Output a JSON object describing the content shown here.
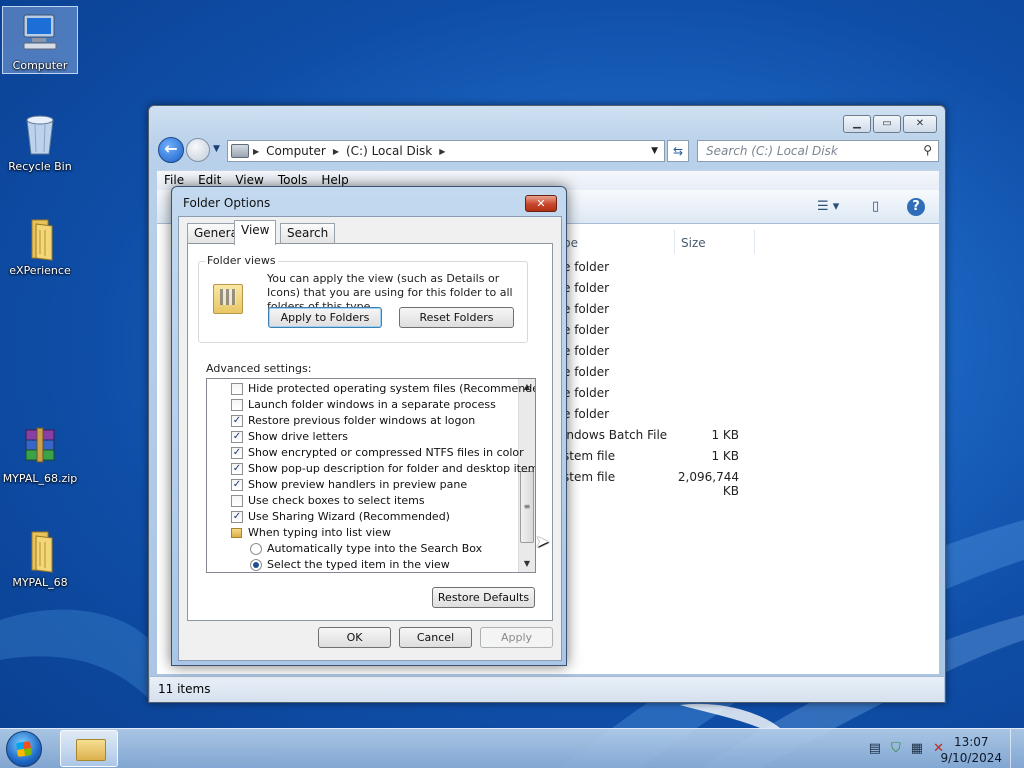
{
  "desktop": {
    "icons": [
      {
        "label": "Computer",
        "icon": "computer-icon"
      },
      {
        "label": "Recycle Bin",
        "icon": "recycle-bin-icon"
      },
      {
        "label": "eXPerience",
        "icon": "folder-icon"
      },
      {
        "label": "MYPAL_68.zip",
        "icon": "winrar-archive-icon"
      },
      {
        "label": "MYPAL_68",
        "icon": "folder-icon"
      }
    ]
  },
  "explorer": {
    "address": {
      "crumbs": [
        "Computer",
        "(C:) Local Disk"
      ]
    },
    "search": {
      "placeholder": "Search (C:) Local Disk"
    },
    "menu": [
      "File",
      "Edit",
      "View",
      "Tools",
      "Help"
    ],
    "columns": {
      "type_partial": "pe",
      "size": "Size"
    },
    "rows": [
      {
        "type": "e folder",
        "size": ""
      },
      {
        "type": "e folder",
        "size": ""
      },
      {
        "type": "e folder",
        "size": ""
      },
      {
        "type": "e folder",
        "size": ""
      },
      {
        "type": "e folder",
        "size": ""
      },
      {
        "type": "e folder",
        "size": ""
      },
      {
        "type": "e folder",
        "size": ""
      },
      {
        "type": "e folder",
        "size": ""
      },
      {
        "type": "indows Batch File",
        "size": "1 KB"
      },
      {
        "type": "stem file",
        "size": "1 KB"
      },
      {
        "type": "stem file",
        "size": "2,096,744 KB"
      }
    ],
    "status": "11 items"
  },
  "dialog": {
    "title": "Folder Options",
    "tabs": [
      "General",
      "View",
      "Search"
    ],
    "active_tab": "View",
    "folder_views": {
      "label": "Folder views",
      "description": "You can apply the view (such as Details or Icons) that you are using for this folder to all folders of this type.",
      "apply_button": "Apply to Folders",
      "reset_button": "Reset Folders"
    },
    "advanced_label": "Advanced settings:",
    "advanced_items": [
      {
        "kind": "checkbox",
        "label": "Hide protected operating system files (Recommended)",
        "checked": false,
        "indent": 0
      },
      {
        "kind": "checkbox",
        "label": "Launch folder windows in a separate process",
        "checked": false,
        "indent": 0
      },
      {
        "kind": "checkbox",
        "label": "Restore previous folder windows at logon",
        "checked": true,
        "indent": 0
      },
      {
        "kind": "checkbox",
        "label": "Show drive letters",
        "checked": true,
        "indent": 0
      },
      {
        "kind": "checkbox",
        "label": "Show encrypted or compressed NTFS files in color",
        "checked": true,
        "indent": 0
      },
      {
        "kind": "checkbox",
        "label": "Show pop-up description for folder and desktop items",
        "checked": true,
        "indent": 0
      },
      {
        "kind": "checkbox",
        "label": "Show preview handlers in preview pane",
        "checked": true,
        "indent": 0
      },
      {
        "kind": "checkbox",
        "label": "Use check boxes to select items",
        "checked": false,
        "indent": 0
      },
      {
        "kind": "checkbox",
        "label": "Use Sharing Wizard (Recommended)",
        "checked": true,
        "indent": 0
      },
      {
        "kind": "folder",
        "label": "When typing into list view",
        "checked": false,
        "indent": 0
      },
      {
        "kind": "radio",
        "label": "Automatically type into the Search Box",
        "checked": false,
        "indent": 1
      },
      {
        "kind": "radio",
        "label": "Select the typed item in the view",
        "checked": true,
        "indent": 1
      }
    ],
    "restore_defaults": "Restore Defaults",
    "ok": "OK",
    "cancel": "Cancel",
    "apply": "Apply"
  },
  "taskbar": {
    "time": "13:07",
    "date": "9/10/2024"
  }
}
